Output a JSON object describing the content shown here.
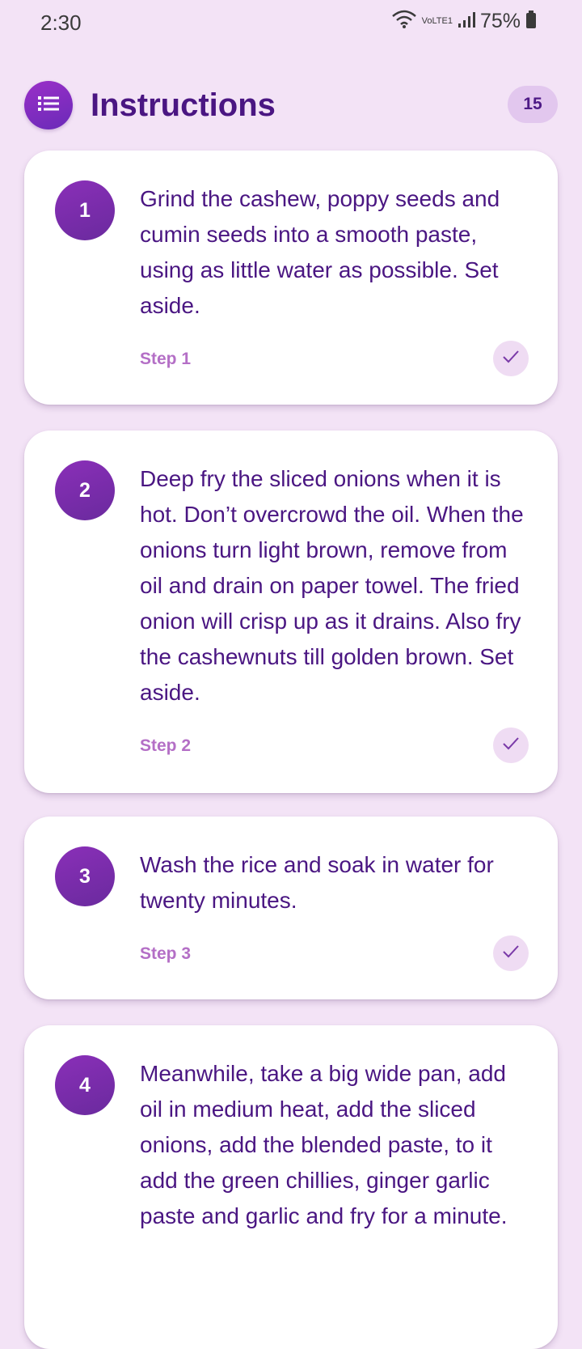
{
  "status_bar": {
    "time": "2:30",
    "battery": "75%",
    "network": "VoLTE1"
  },
  "header": {
    "title": "Instructions",
    "count": "15",
    "menu_icon": "list-icon"
  },
  "steps": [
    {
      "number": "1",
      "text": "Grind the cashew, poppy seeds and cumin seeds into a smooth paste, using as little water as possible. Set aside.",
      "label": "Step 1",
      "check_icon": "check-icon"
    },
    {
      "number": "2",
      "text": "Deep fry the sliced onions when it is hot. Don’t overcrowd the oil. When the onions turn light brown, remove from oil and drain on paper towel. The fried onion will crisp up as it drains. Also fry the cashewnuts till golden brown. Set aside.",
      "label": "Step 2",
      "check_icon": "check-icon"
    },
    {
      "number": "3",
      "text": "Wash the rice and soak in water for twenty minutes.",
      "label": "Step 3",
      "check_icon": "check-icon"
    },
    {
      "number": "4",
      "text": "Meanwhile, take a big wide pan, add oil in medium heat, add the sliced onions, add the blended paste, to it add the green chillies, ginger garlic paste and garlic and fry for a minute.",
      "label": "",
      "check_icon": ""
    }
  ],
  "colors": {
    "background": "#f3e3f6",
    "accent": "#6a2ab8",
    "title": "#4a1682",
    "step_label": "#b46fc6"
  }
}
